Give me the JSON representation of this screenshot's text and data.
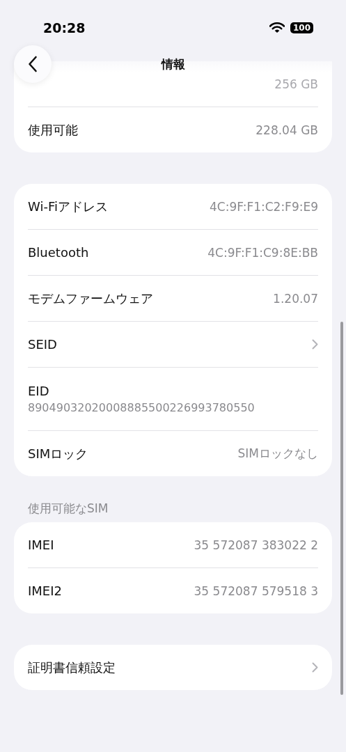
{
  "status_bar": {
    "time": "20:28",
    "battery": "100"
  },
  "nav": {
    "title": "情報"
  },
  "sections": [
    {
      "rows": [
        {
          "kind": "faded",
          "value": "256 GB"
        },
        {
          "kind": "value",
          "label": "使用可能",
          "value": "228.04 GB"
        }
      ]
    },
    {
      "rows": [
        {
          "kind": "value",
          "label": "Wi-Fiアドレス",
          "value": "4C:9F:F1:C2:F9:E9"
        },
        {
          "kind": "value",
          "label": "Bluetooth",
          "value": "4C:9F:F1:C9:8E:BB"
        },
        {
          "kind": "value",
          "label": "モデムファームウェア",
          "value": "1.20.07"
        },
        {
          "kind": "link",
          "label": "SEID"
        },
        {
          "kind": "stacked",
          "label": "EID",
          "value": "89049032020008885500226993780550"
        },
        {
          "kind": "value",
          "label": "SIMロック",
          "value": "SIMロックなし"
        }
      ]
    },
    {
      "header": "使用可能なSIM",
      "rows": [
        {
          "kind": "value",
          "label": "IMEI",
          "value": "35 572087 383022 2"
        },
        {
          "kind": "value",
          "label": "IMEI2",
          "value": "35 572087 579518 3"
        }
      ]
    },
    {
      "rows": [
        {
          "kind": "link",
          "label": "証明書信頼設定"
        }
      ]
    }
  ]
}
